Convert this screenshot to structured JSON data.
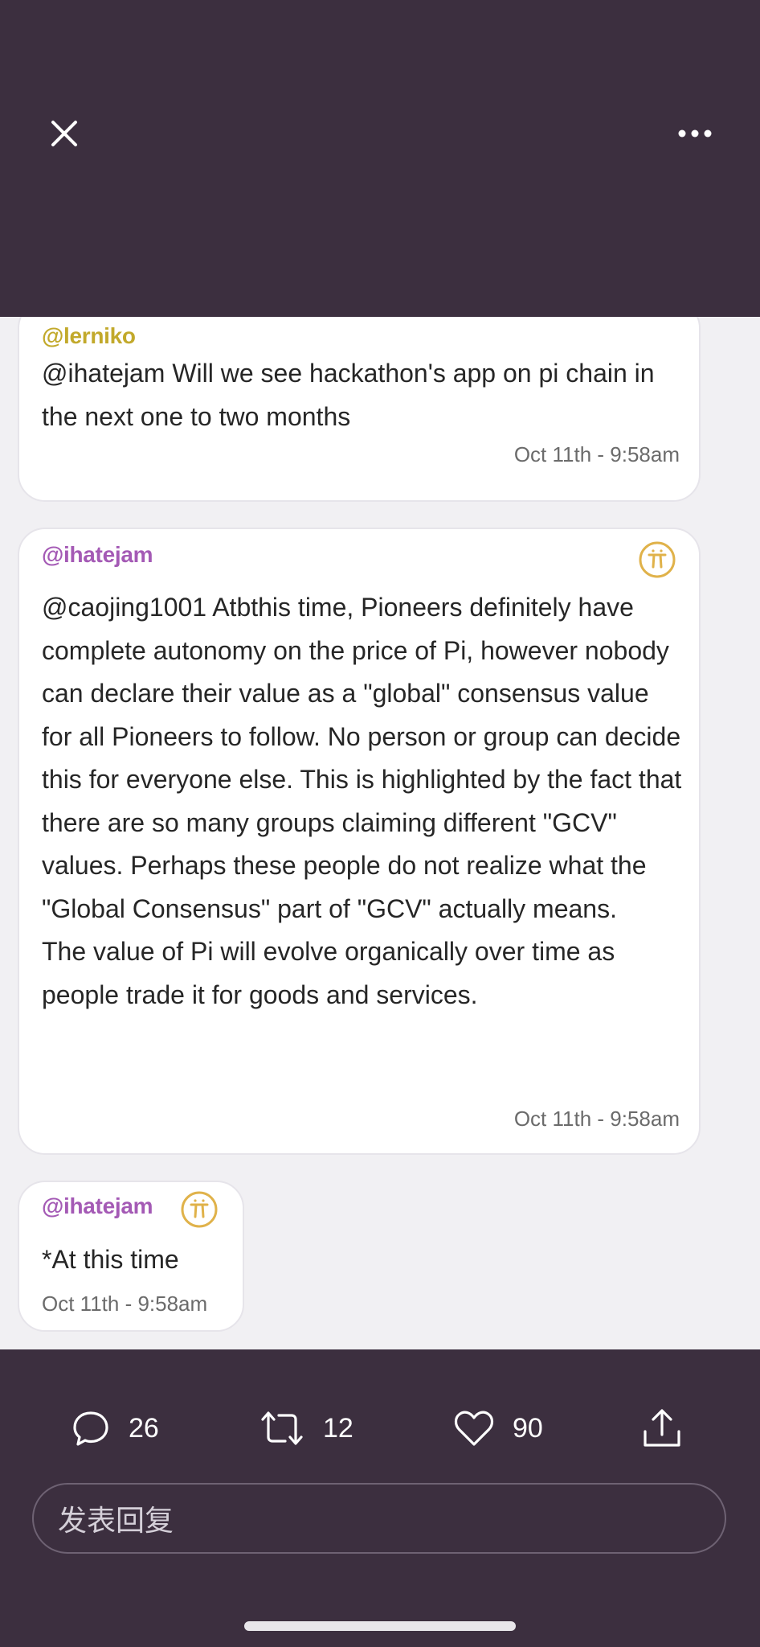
{
  "topbar": {
    "close_icon": "close-icon",
    "more_icon": "more-horizontal-icon"
  },
  "messages": [
    {
      "username": "@lerniko",
      "username_color": "#c2a92b",
      "text": "@ihatejam Will we see hackathon's app on pi chain in the next one to two months",
      "timestamp": "Oct 11th - 9:58am",
      "badge": null
    },
    {
      "username": "@ihatejam",
      "username_color": "#a45ab5",
      "text": "@caojing1001 Atbthis time, Pioneers definitely have complete autonomy on the price of Pi, however nobody can declare their value as a \"global\" consensus value for all Pioneers to follow. No person or group can decide this for everyone else. This is highlighted by the fact that there are so many groups claiming different \"GCV\" values. Perhaps these people do not realize what the \"Global Consensus\" part of \"GCV\" actually means.\nThe value of Pi will evolve organically over time as people trade it for goods and services.",
      "timestamp": "Oct 11th - 9:58am",
      "badge": "pi-core-team-icon"
    },
    {
      "username": "@ihatejam",
      "username_color": "#a45ab5",
      "text": "*At this time",
      "timestamp": "Oct 11th - 9:58am",
      "badge": "pi-core-team-icon"
    }
  ],
  "actions": {
    "reply_count": "26",
    "retweet_count": "12",
    "like_count": "90",
    "icons": [
      "comment-icon",
      "retweet-icon",
      "heart-icon",
      "share-icon"
    ]
  },
  "reply_box": {
    "placeholder": "发表回复"
  },
  "colors": {
    "chrome_background": "#3c2f3f",
    "content_background": "#f1f0f3",
    "badge_gold": "#e0b24a"
  }
}
